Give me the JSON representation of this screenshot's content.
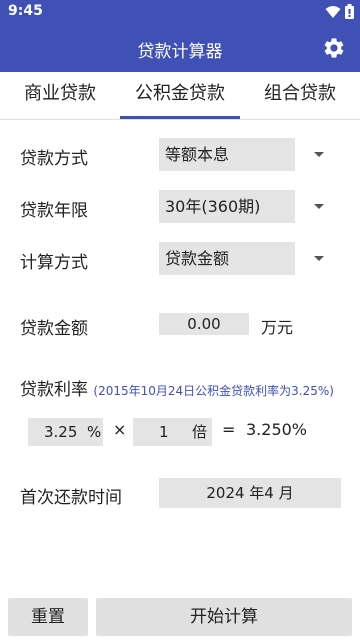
{
  "status": {
    "time": "9:45",
    "icons": [
      "wifi-icon",
      "battery-icon"
    ]
  },
  "appbar": {
    "title": "贷款计算器",
    "settings_icon": "gear-icon"
  },
  "tabs": [
    {
      "label": "商业贷款",
      "active": false
    },
    {
      "label": "公积金贷款",
      "active": true
    },
    {
      "label": "组合贷款",
      "active": false
    }
  ],
  "form": {
    "method": {
      "label": "贷款方式",
      "value": "等额本息"
    },
    "term": {
      "label": "贷款年限",
      "value": "30年(360期)"
    },
    "calc": {
      "label": "计算方式",
      "value": "贷款金额"
    },
    "amount": {
      "label": "贷款金额",
      "value": "0.00",
      "unit": "万元"
    },
    "rate": {
      "label": "贷款利率",
      "hint": "(2015年10月24日公积金贷款利率为3.25%)",
      "base": "3.25",
      "base_unit": "%",
      "times_sign": "×",
      "multiplier": "1",
      "multiplier_unit": "倍",
      "equals_sign": "=",
      "result": "3.250%"
    },
    "first_payment": {
      "label": "首次还款时间",
      "value": "2024 年4 月"
    }
  },
  "buttons": {
    "reset": "重置",
    "start": "开始计算"
  },
  "colors": {
    "primary": "#3f51b5",
    "field_bg": "#e4e4e4"
  }
}
